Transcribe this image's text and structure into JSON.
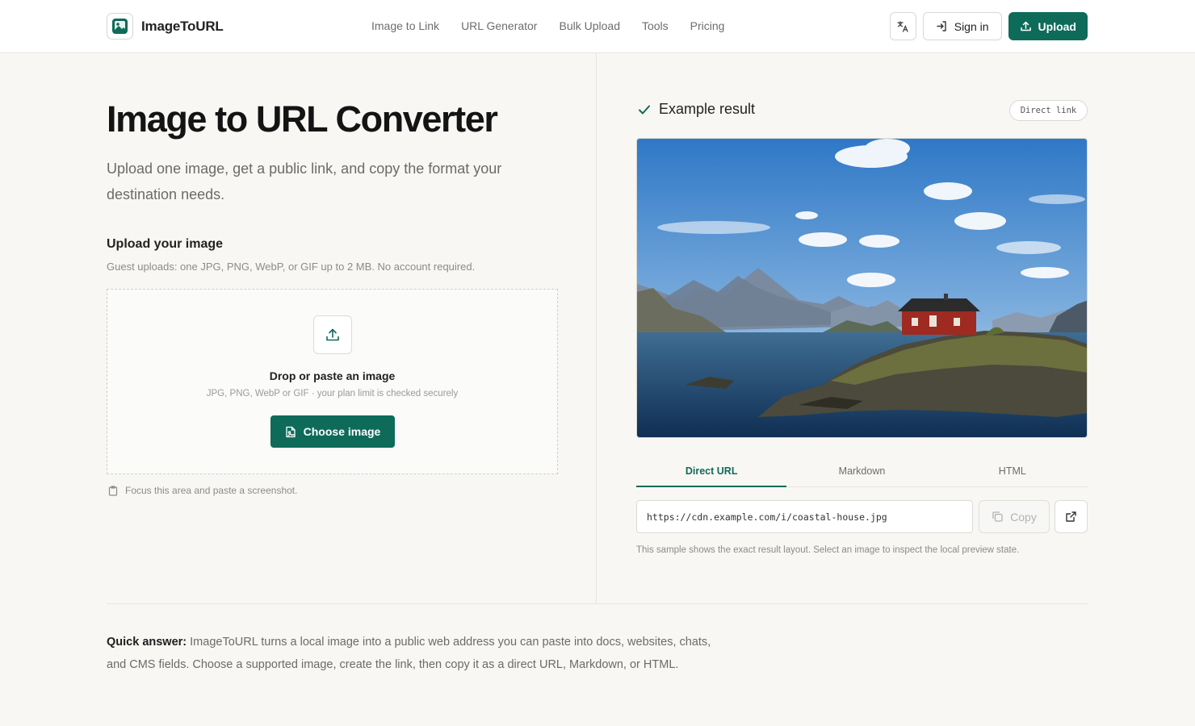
{
  "header": {
    "logo_text": "ImageToURL",
    "nav": [
      "Image to Link",
      "URL Generator",
      "Bulk Upload",
      "Tools",
      "Pricing"
    ],
    "signin_label": "Sign in",
    "upload_label": "Upload"
  },
  "hero": {
    "title": "Image to URL Converter",
    "subtitle": "Upload one image, get a public link, and copy the format your destination needs."
  },
  "uploader": {
    "label": "Upload your image",
    "hint": "Guest uploads: one JPG, PNG, WebP, or GIF up to 2 MB. No account required.",
    "drop_title": "Drop or paste an image",
    "drop_sub": "JPG, PNG, WebP or GIF · your plan limit is checked securely",
    "choose_label": "Choose image",
    "paste_note": "Focus this area and paste a screenshot."
  },
  "result": {
    "title": "Example result",
    "badge": "Direct link",
    "tabs": [
      "Direct URL",
      "Markdown",
      "HTML"
    ],
    "active_tab": "Direct URL",
    "url": "https://cdn.example.com/i/coastal-house.jpg",
    "copy_label": "Copy",
    "note": "This sample shows the exact result layout. Select an image to inspect the local preview state."
  },
  "quick_answer": {
    "label": "Quick answer:",
    "text": " ImageToURL turns a local image into a public web address you can paste into docs, websites, chats, and CMS fields. Choose a supported image, create the link, then copy it as a direct URL, Markdown, or HTML."
  },
  "colors": {
    "accent": "#0e6b5a",
    "background": "#f8f7f4"
  },
  "icons": [
    "logo-icon",
    "translate-icon",
    "sign-in-icon",
    "upload-icon",
    "upload-arrow-icon",
    "file-image-icon",
    "clipboard-icon",
    "check-icon",
    "copy-icon",
    "external-link-icon"
  ]
}
